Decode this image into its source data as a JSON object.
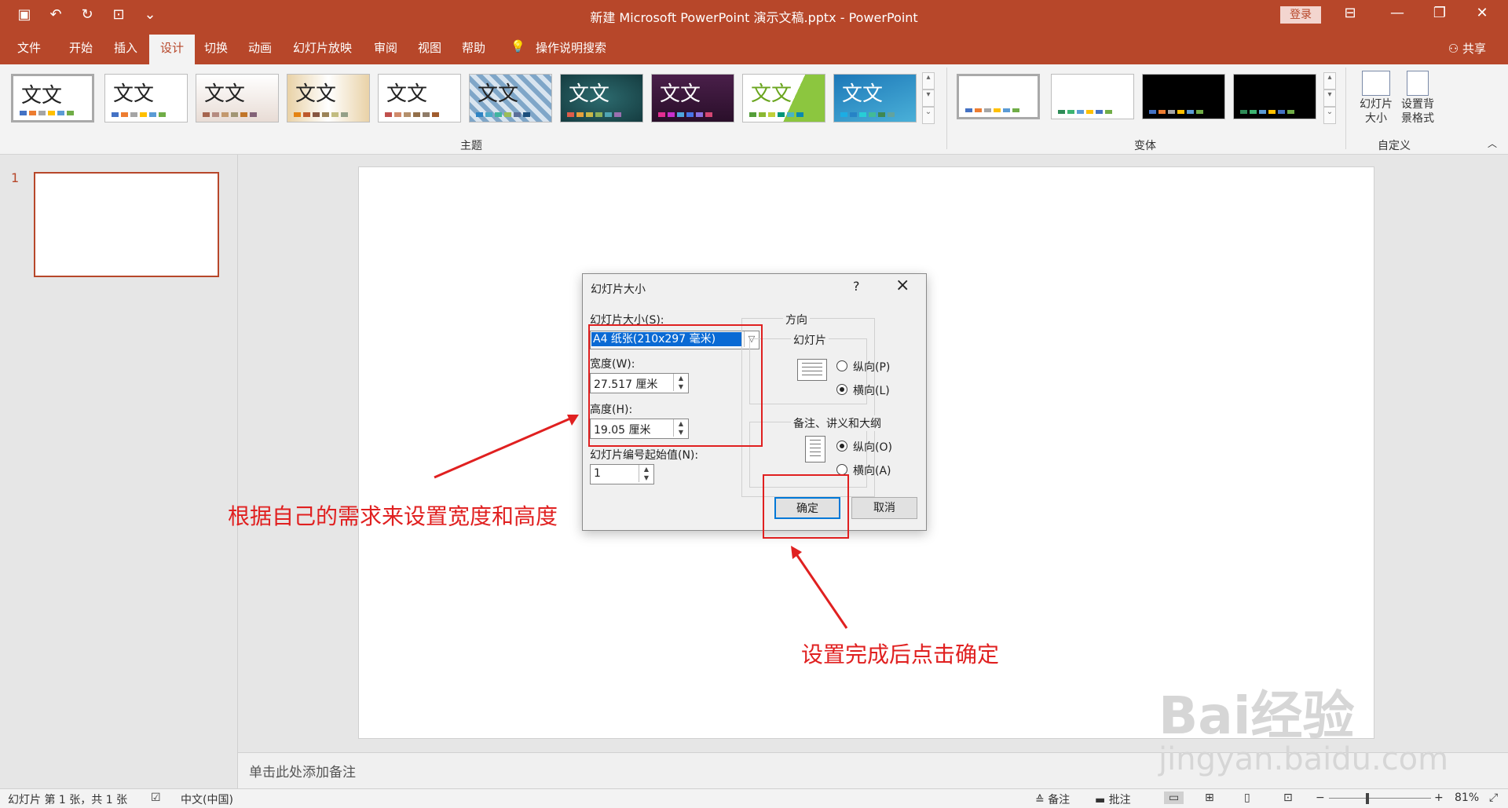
{
  "titlebar": {
    "title": "新建 Microsoft PowerPoint 演示文稿.pptx  -  PowerPoint",
    "login_label": "登录",
    "icons": [
      "save-icon",
      "undo-icon",
      "redo-icon",
      "presentation-icon",
      "customize-qat-icon"
    ]
  },
  "menu": {
    "items": [
      "文件",
      "开始",
      "插入",
      "设计",
      "切换",
      "动画",
      "幻灯片放映",
      "审阅",
      "视图",
      "帮助"
    ],
    "active": "设计",
    "tell_me": "操作说明搜索",
    "share": "共享"
  },
  "ribbon": {
    "themes_label": "主题",
    "variants_label": "变体",
    "customize_label": "自定义",
    "theme_text": "文文",
    "slide_size_label": "幻灯片大小",
    "format_bg_label": "设置背景格式"
  },
  "slides": {
    "number": "1"
  },
  "notes": {
    "placeholder": "单击此处添加备注"
  },
  "status": {
    "slide_info": "幻灯片 第 1 张，共 1 张",
    "language": "中文(中国)",
    "notes_label": "备注",
    "comments_label": "批注",
    "zoom": "81%"
  },
  "dialog": {
    "title": "幻灯片大小",
    "help": "?",
    "size_label": "幻灯片大小(S):",
    "size_value": "A4 纸张(210x297 毫米)",
    "width_label": "宽度(W):",
    "width_value": "27.517 厘米",
    "height_label": "高度(H):",
    "height_value": "19.05 厘米",
    "numbering_label": "幻灯片编号起始值(N):",
    "numbering_value": "1",
    "orientation_label": "方向",
    "slides_group": "幻灯片",
    "portrait_label": "纵向(P)",
    "landscape_label": "横向(L)",
    "notes_group": "备注、讲义和大纲",
    "notes_portrait_label": "纵向(O)",
    "notes_landscape_label": "横向(A)",
    "ok_label": "确定",
    "cancel_label": "取消"
  },
  "annotations": {
    "left_text": "根据自己的需求来设置宽度和高度",
    "bottom_text": "设置完成后点击确定",
    "color": "#e02020"
  },
  "watermark": {
    "brand": "Bai经验",
    "url": "jingyan.baidu.com"
  }
}
